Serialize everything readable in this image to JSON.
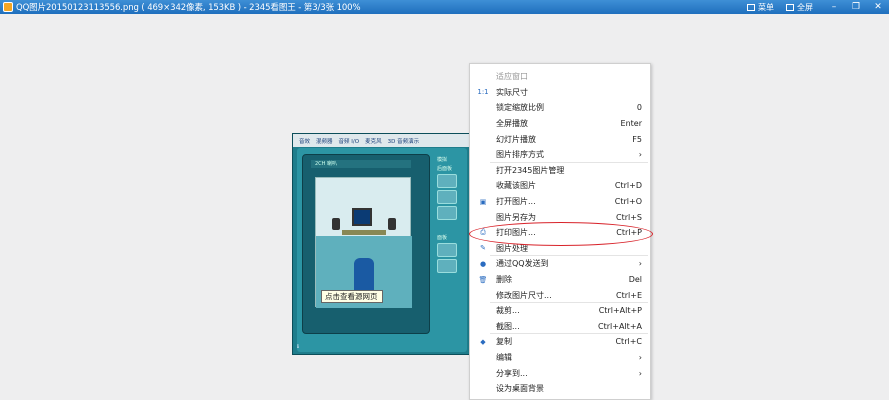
{
  "window": {
    "title": "QQ图片20150123113556.png ( 469×342像素, 153KB ) - 2345看图王 - 第3/3张 100%",
    "menu_label": "菜单",
    "fullscreen_label": "全屏",
    "minimize_glyph": "–",
    "restore_glyph": "❐",
    "close_glyph": "✕"
  },
  "image": {
    "tabs": [
      "音效",
      "混频器",
      "音频 I/O",
      "麦克风",
      "3D 音频演示"
    ],
    "dropdown_value": "2CH 喇叭",
    "side_top_label": "模拟",
    "side_sub_label": "后面板",
    "side_bottom_label": "面板",
    "tooltip": "点击查看源网页",
    "footer": "ℹ"
  },
  "menu": {
    "items": [
      {
        "label": "适应窗口",
        "shortcut": "",
        "icon": "",
        "disabled": true
      },
      {
        "label": "实际尺寸",
        "shortcut": "",
        "icon": "actual-size-icon",
        "glyph": "1:1"
      },
      {
        "label": "锁定缩放比例",
        "shortcut": "0",
        "icon": ""
      },
      {
        "label": "全屏播放",
        "shortcut": "Enter",
        "icon": ""
      },
      {
        "label": "幻灯片播放",
        "shortcut": "F5",
        "icon": ""
      },
      {
        "label": "图片排序方式",
        "shortcut": "›",
        "icon": ""
      },
      {
        "label": "打开2345图片管理",
        "shortcut": "",
        "icon": ""
      },
      {
        "label": "收藏该图片",
        "shortcut": "Ctrl+D",
        "icon": ""
      },
      {
        "label": "打开图片...",
        "shortcut": "Ctrl+O",
        "icon": "folder-icon",
        "glyph": "▣"
      },
      {
        "label": "图片另存为",
        "shortcut": "Ctrl+S",
        "icon": ""
      },
      {
        "label": "打印图片...",
        "shortcut": "Ctrl+P",
        "icon": "printer-icon",
        "glyph": "⎙"
      },
      {
        "label": "图片处理",
        "shortcut": "",
        "icon": "edit-image-icon",
        "glyph": "✎"
      },
      {
        "label": "通过QQ发送到",
        "shortcut": "›",
        "icon": "qq-icon",
        "glyph": "●"
      },
      {
        "label": "删除",
        "shortcut": "Del",
        "icon": "trash-icon",
        "glyph": "🗑"
      },
      {
        "label": "修改图片尺寸...",
        "shortcut": "Ctrl+E",
        "icon": ""
      },
      {
        "label": "裁剪...",
        "shortcut": "Ctrl+Alt+P",
        "icon": ""
      },
      {
        "label": "截图...",
        "shortcut": "Ctrl+Alt+A",
        "icon": ""
      },
      {
        "label": "复制",
        "shortcut": "Ctrl+C",
        "icon": "copy-icon",
        "glyph": "◆"
      },
      {
        "label": "编辑",
        "shortcut": "›",
        "icon": ""
      },
      {
        "label": "分享到...",
        "shortcut": "›",
        "icon": ""
      },
      {
        "label": "设为桌面背景",
        "shortcut": "",
        "icon": ""
      }
    ]
  },
  "colors": {
    "titlebar": "#2a7ac8",
    "highlight_circle": "#d8232a",
    "icon_blue": "#2a6cc0"
  }
}
